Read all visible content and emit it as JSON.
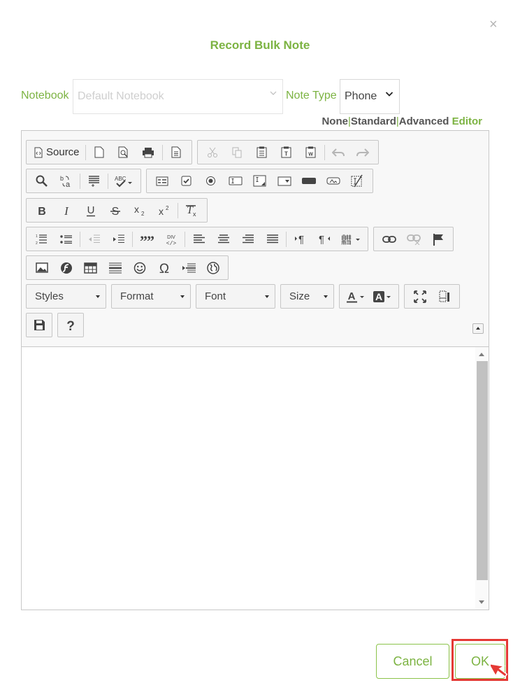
{
  "dialog": {
    "title": "Record Bulk Note",
    "close_label": "×"
  },
  "fields": {
    "notebook": {
      "label": "Notebook",
      "placeholder": "Default Notebook"
    },
    "note_type": {
      "label": "Note Type",
      "value": "Phone"
    }
  },
  "editor_modes": {
    "none": "None",
    "standard": "Standard",
    "advanced": "Advanced",
    "editor": "Editor",
    "separator": "|"
  },
  "toolbar": {
    "source_label": "Source",
    "combos": {
      "styles": "Styles",
      "format": "Format",
      "font": "Font",
      "size": "Size"
    },
    "icons": {
      "row1": [
        "source-icon",
        "new-page-icon",
        "preview-icon",
        "print-icon",
        "templates-icon",
        "cut-icon",
        "copy-icon",
        "paste-icon",
        "paste-text-icon",
        "paste-word-icon",
        "undo-icon",
        "redo-icon"
      ],
      "row2": [
        "find-icon",
        "replace-icon",
        "select-all-icon",
        "spellcheck-icon",
        "form-icon",
        "checkbox-icon",
        "radio-icon",
        "textfield-icon",
        "textarea-icon",
        "select-icon",
        "button-icon",
        "image-button-icon",
        "hidden-field-icon"
      ],
      "row3": [
        "bold-icon",
        "italic-icon",
        "underline-icon",
        "strike-icon",
        "subscript-icon",
        "superscript-icon",
        "remove-format-icon"
      ],
      "row4": [
        "numbered-list-icon",
        "bulleted-list-icon",
        "outdent-icon",
        "indent-icon",
        "blockquote-icon",
        "div-icon",
        "align-left-icon",
        "align-center-icon",
        "align-right-icon",
        "justify-icon",
        "ltr-icon",
        "rtl-icon",
        "language-icon",
        "link-icon",
        "unlink-icon",
        "anchor-icon"
      ],
      "row5": [
        "image-icon",
        "flash-icon",
        "table-icon",
        "horizontal-rule-icon",
        "smiley-icon",
        "special-char-icon",
        "page-break-icon",
        "iframe-icon"
      ],
      "row6": [
        "text-color-icon",
        "bg-color-icon",
        "maximize-icon",
        "show-blocks-icon"
      ],
      "row7": [
        "save-icon",
        "help-icon"
      ]
    }
  },
  "buttons": {
    "cancel": "Cancel",
    "ok": "OK"
  },
  "colors": {
    "accent": "#7cb342",
    "highlight": "#e53935"
  }
}
